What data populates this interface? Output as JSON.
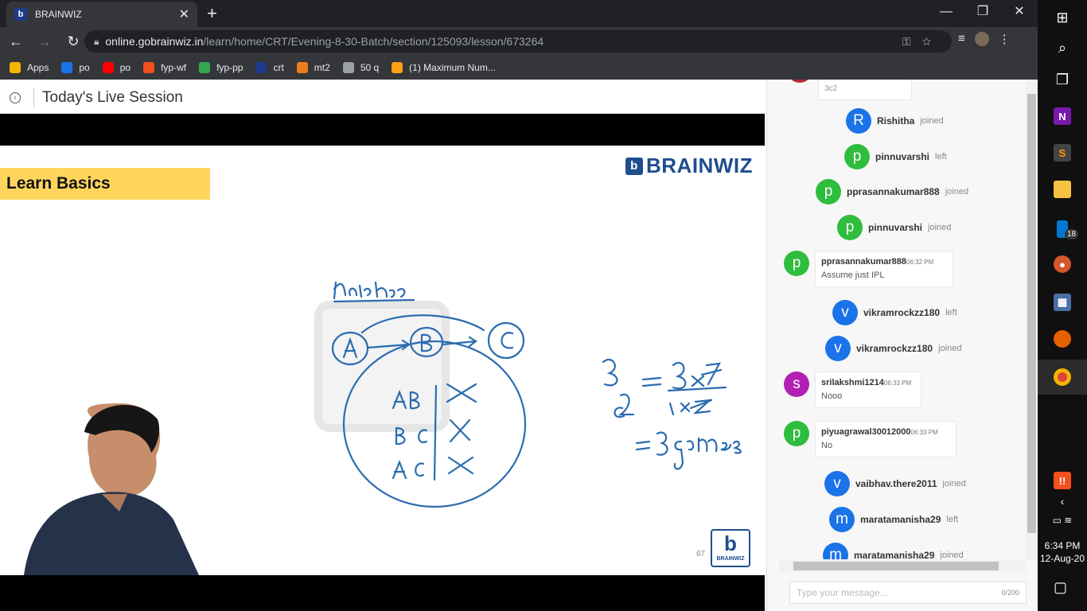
{
  "browser": {
    "tab_title": "BRAINWIZ",
    "tab_close": "✕",
    "new_tab": "+",
    "window_controls": [
      "—",
      "❐",
      "✕"
    ],
    "url_host": "online.gobrainwiz.in",
    "url_path": "/learn/home/CRT/Evening-8-30-Batch/section/125093/lesson/673264",
    "bookmarks": [
      {
        "label": "Apps",
        "icon": "apps-grid-icon",
        "color": "#f4b400"
      },
      {
        "label": "po",
        "icon": "edge-icon",
        "color": "#1a73e8"
      },
      {
        "label": "po",
        "icon": "youtube-icon",
        "color": "#ff0000"
      },
      {
        "label": "fyp-wf",
        "icon": "figma-icon",
        "color": "#f24e1e"
      },
      {
        "label": "fyp-pp",
        "icon": "site-icon",
        "color": "#34a853"
      },
      {
        "label": "crt",
        "icon": "brainwiz-icon",
        "color": "#1e3a8a"
      },
      {
        "label": "mt2",
        "icon": "cc-icon",
        "color": "#ee7d22"
      },
      {
        "label": "50 q",
        "icon": "globe-icon",
        "color": "#9aa0a6"
      },
      {
        "label": "(1) Maximum Num...",
        "icon": "leetcode-icon",
        "color": "#ffa116"
      }
    ]
  },
  "page": {
    "title": "Today's Live Session"
  },
  "slide": {
    "banner": "Learn Basics",
    "logo_text": "BRAINWIZ",
    "page_number": "67",
    "badge_text": "BRAINWIZ"
  },
  "chat": {
    "top_partial": "3c2",
    "events": [
      {
        "initial": "R",
        "name": "Rishitha",
        "status": "joined",
        "color": "#1a73e8"
      },
      {
        "initial": "p",
        "name": "pinnuvarshi",
        "status": "left",
        "color": "#2ebd3c"
      },
      {
        "initial": "p",
        "name": "pprasannakumar888",
        "status": "joined",
        "color": "#2ebd3c"
      },
      {
        "initial": "p",
        "name": "pinnuvarshi",
        "status": "joined",
        "color": "#2ebd3c"
      },
      {
        "initial": "v",
        "name": "vikramrockzz180",
        "status": "left",
        "color": "#1a73e8"
      },
      {
        "initial": "v",
        "name": "vikramrockzz180",
        "status": "joined",
        "color": "#1a73e8"
      },
      {
        "initial": "v",
        "name": "vaibhav.there2011",
        "status": "joined",
        "color": "#1a73e8"
      },
      {
        "initial": "m",
        "name": "maratamanisha29",
        "status": "left",
        "color": "#1a73e8"
      },
      {
        "initial": "m",
        "name": "maratamanisha29",
        "status": "joined",
        "color": "#1a73e8"
      }
    ],
    "messages": [
      {
        "initial": "p",
        "name": "pprasannakumar888",
        "time": "06:32 PM",
        "text": "Assume just IPL",
        "color": "#2ebd3c"
      },
      {
        "initial": "s",
        "name": "srilakshmi1214",
        "time": "06:33 PM",
        "text": "Nooo",
        "color": "#b31fb3"
      },
      {
        "initial": "p",
        "name": "piyuagrawal30012000",
        "time": "06:33 PM",
        "text": "No",
        "color": "#2ebd3c"
      }
    ],
    "input_placeholder": "Type your message...",
    "char_count": "0/200"
  },
  "taskbar": {
    "time": "6:34 PM",
    "date": "12-Aug-20",
    "badge_count": "18"
  }
}
